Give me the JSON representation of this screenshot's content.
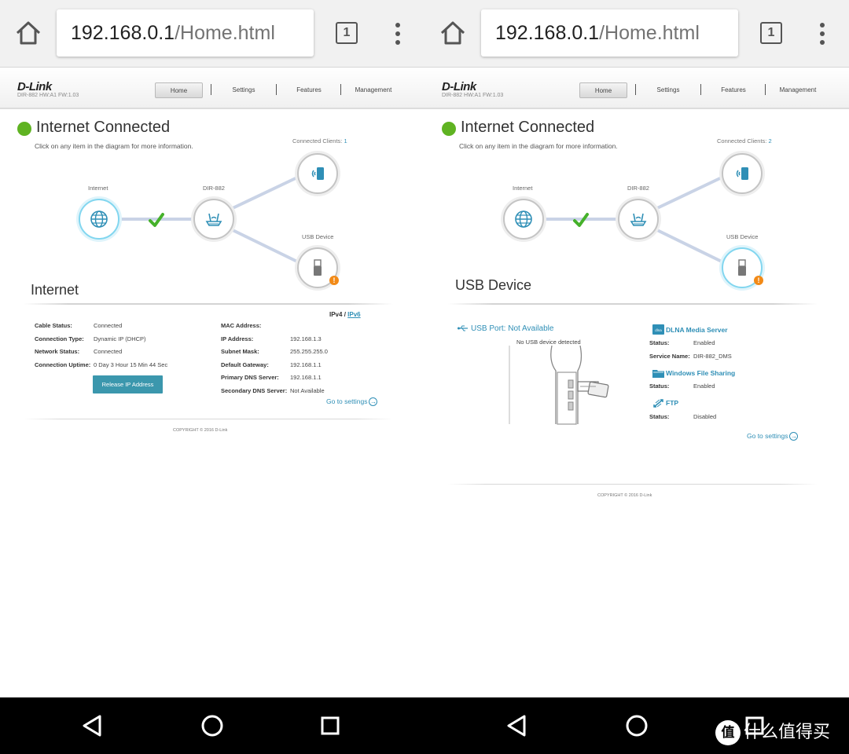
{
  "colors": {
    "accent": "#2f8fb6",
    "connected_green": "#5fb322",
    "warning_orange": "#f28a17",
    "button_teal": "#3b97ad"
  },
  "left": {
    "browser": {
      "url_host": "192.168.0.1",
      "url_path": "/Home.html",
      "tab_count": "1"
    },
    "header": {
      "logo": "D-Link",
      "model": "DIR-882 HW:A1 FW:1.03",
      "nav": [
        "Home",
        "Settings",
        "Features",
        "Management"
      ],
      "active_nav": "Home"
    },
    "status": {
      "title": "Internet Connected",
      "hint": "Click on any item in the diagram for more information.",
      "clients_label": "Connected Clients:",
      "clients_count": "1"
    },
    "diagram": {
      "internet": "Internet",
      "router": "DIR-882",
      "usb": "USB Device",
      "selected": "Internet"
    },
    "section_title": "Internet",
    "ipv": {
      "ipv4": "IPv4",
      "sep": "/",
      "ipv6": "IPv6"
    },
    "details_left": [
      {
        "label": "Cable Status:",
        "value": "Connected"
      },
      {
        "label": "Connection Type:",
        "value": "Dynamic IP (DHCP)"
      },
      {
        "label": "Network Status:",
        "value": "Connected"
      },
      {
        "label": "Connection Uptime:",
        "value": "0 Day 3 Hour 15 Min 44 Sec"
      }
    ],
    "details_right": [
      {
        "label": "MAC Address:",
        "value": ""
      },
      {
        "label": "IP Address:",
        "value": "192.168.1.3"
      },
      {
        "label": "Subnet Mask:",
        "value": "255.255.255.0"
      },
      {
        "label": "Default Gateway:",
        "value": "192.168.1.1"
      },
      {
        "label": "Primary DNS Server:",
        "value": "192.168.1.1"
      },
      {
        "label": "Secondary DNS Server:",
        "value": "Not Available"
      }
    ],
    "release_button": "Release IP Address",
    "goto_settings": "Go to settings",
    "copyright": "COPYRIGHT © 2016 D-Link"
  },
  "right": {
    "browser": {
      "url_host": "192.168.0.1",
      "url_path": "/Home.html",
      "tab_count": "1"
    },
    "header": {
      "logo": "D-Link",
      "model": "DIR-882 HW:A1 FW:1.03",
      "nav": [
        "Home",
        "Settings",
        "Features",
        "Management"
      ],
      "active_nav": "Home"
    },
    "status": {
      "title": "Internet Connected",
      "hint": "Click on any item in the diagram for more information.",
      "clients_label": "Connected Clients:",
      "clients_count": "2"
    },
    "diagram": {
      "internet": "Internet",
      "router": "DIR-882",
      "usb": "USB Device",
      "selected": "USB Device"
    },
    "section_title": "USB Device",
    "usb": {
      "port_label": "USB Port:",
      "port_value": "Not Available",
      "no_device": "No USB device detected"
    },
    "services": [
      {
        "icon": "dlna-icon",
        "title": "DLNA Media Server",
        "rows": [
          {
            "label": "Status:",
            "value": "Enabled"
          },
          {
            "label": "Service Name:",
            "value": "DIR-882_DMS"
          }
        ]
      },
      {
        "icon": "folder-icon",
        "title": "Windows File Sharing",
        "rows": [
          {
            "label": "Status:",
            "value": "Enabled"
          }
        ]
      },
      {
        "icon": "ftp-icon",
        "title": "FTP",
        "rows": [
          {
            "label": "Status:",
            "value": "Disabled"
          }
        ]
      }
    ],
    "goto_settings": "Go to settings",
    "copyright": "COPYRIGHT © 2016 D-Link"
  },
  "watermark": {
    "badge": "值",
    "text": "什么值得买"
  }
}
